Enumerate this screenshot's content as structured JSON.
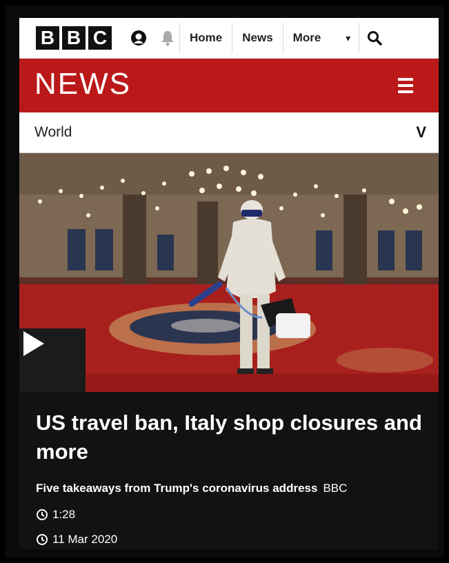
{
  "topbar": {
    "logo_letters": [
      "B",
      "B",
      "C"
    ],
    "nav": [
      {
        "label": "Home"
      },
      {
        "label": "News"
      },
      {
        "label": "More"
      }
    ],
    "icons": [
      "account-icon",
      "notification-bell-icon",
      "search-icon"
    ]
  },
  "news_bar": {
    "brand": "NEWS",
    "menu_icon": "hamburger-menu-icon"
  },
  "section": {
    "label": "World",
    "chevron": "V"
  },
  "hero": {
    "play_icon": "play-icon"
  },
  "story": {
    "headline": "US travel ban, Italy shop closures and more",
    "summary": "Five takeaways from Trump's coronavirus address",
    "source": "BBC",
    "duration": "1:28",
    "date": "11 Mar 2020"
  },
  "colors": {
    "bbc_red": "#bb1919",
    "background": "#121212",
    "white": "#ffffff"
  }
}
